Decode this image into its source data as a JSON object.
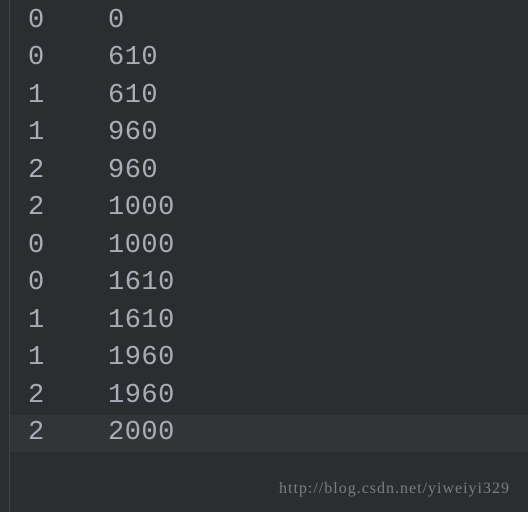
{
  "rows": [
    {
      "col1": "0",
      "col2": "0",
      "highlighted": false
    },
    {
      "col1": "0",
      "col2": "610",
      "highlighted": false
    },
    {
      "col1": "1",
      "col2": "610",
      "highlighted": false
    },
    {
      "col1": "1",
      "col2": "960",
      "highlighted": false
    },
    {
      "col1": "2",
      "col2": "960",
      "highlighted": false
    },
    {
      "col1": "2",
      "col2": "1000",
      "highlighted": false
    },
    {
      "col1": "0",
      "col2": "1000",
      "highlighted": false
    },
    {
      "col1": "0",
      "col2": "1610",
      "highlighted": false
    },
    {
      "col1": "1",
      "col2": "1610",
      "highlighted": false
    },
    {
      "col1": "1",
      "col2": "1960",
      "highlighted": false
    },
    {
      "col1": "2",
      "col2": "1960",
      "highlighted": false
    },
    {
      "col1": "2",
      "col2": "2000",
      "highlighted": true
    }
  ],
  "watermark": "http://blog.csdn.net/yiweiyi329"
}
